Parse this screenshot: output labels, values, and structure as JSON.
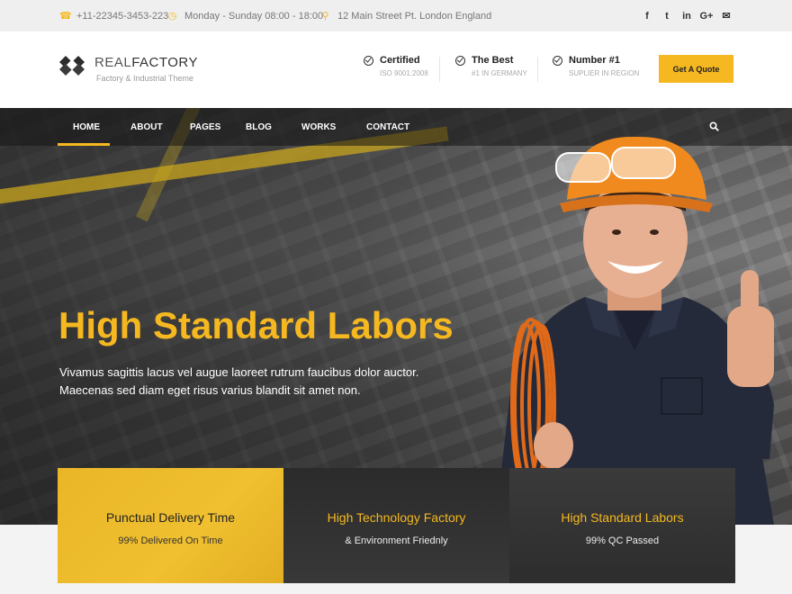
{
  "topbar": {
    "phone": "+11-22345-3453-223",
    "hours": "Monday - Sunday 08:00 - 18:00",
    "address": "12 Main Street Pt. London England",
    "social": [
      "f",
      "t",
      "in",
      "G+",
      "✉"
    ]
  },
  "header": {
    "logo_real": "REAL",
    "logo_factory": "FACTORY",
    "tagline": "Factory & Industrial Theme",
    "features": [
      {
        "title": "Certified",
        "sub": "ISO 9001:2008"
      },
      {
        "title": "The Best",
        "sub": "#1 IN GERMANY"
      },
      {
        "title": "Number #1",
        "sub": "SUPLIER IN REGION"
      }
    ],
    "quote_button": "Get A Quote"
  },
  "nav": {
    "items": [
      "HOME",
      "ABOUT",
      "PAGES",
      "BLOG",
      "WORKS",
      "CONTACT"
    ],
    "active": "HOME"
  },
  "hero": {
    "title": "High Standard Labors",
    "text": "Vivamus sagittis lacus vel augue laoreet rutrum faucibus dolor auctor. Maecenas sed diam eget risus varius blandit sit amet non."
  },
  "cards": [
    {
      "title": "Punctual Delivery Time",
      "sub": "99% Delivered On Time"
    },
    {
      "title": "High Technology Factory",
      "sub": "& Environment Friednly"
    },
    {
      "title": "High Standard Labors",
      "sub": "99% QC Passed"
    }
  ],
  "colors": {
    "accent": "#f5b820",
    "dark": "#2b2b2b"
  }
}
